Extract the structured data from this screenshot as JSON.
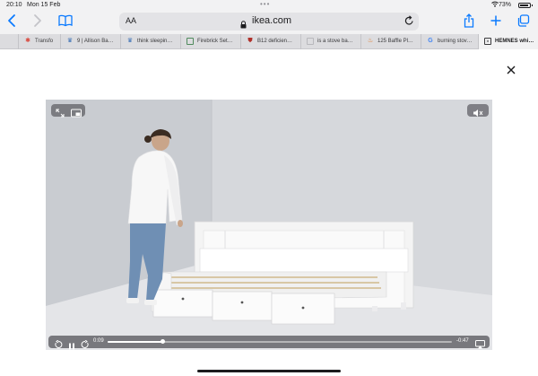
{
  "status": {
    "time": "20:10",
    "date": "Mon 15 Feb",
    "battery": "73%",
    "battery_level": 0.73
  },
  "toolbar": {
    "text_size_label": "AA",
    "url": "ikea.com"
  },
  "tabs": [
    {
      "label": "Transfo",
      "favicon": "star-icon",
      "color": "#d9453a"
    },
    {
      "label": "9 | Allison Ba…",
      "favicon": "crown-icon",
      "color": "#3a6fb5"
    },
    {
      "label": "think sleepin…",
      "favicon": "crown-icon",
      "color": "#3a6fb5"
    },
    {
      "label": "Firebrick Set…",
      "favicon": "grid-icon",
      "color": "#4f8a5c"
    },
    {
      "label": "B12 deficien…",
      "favicon": "shield-icon",
      "color": "#b0302a"
    },
    {
      "label": "is a stove ba…",
      "favicon": "blank-page-icon",
      "color": "#b8b8bc"
    },
    {
      "label": "125 Baffle Pl…",
      "favicon": "flame-icon",
      "color": "#e07a2a"
    },
    {
      "label": "burning stov…",
      "favicon": "google-icon",
      "color": "#4285f4"
    },
    {
      "label": "HEMNES whi…",
      "favicon": "close-tab-icon",
      "color": "#3a3a3c"
    }
  ],
  "video": {
    "elapsed": "0:09",
    "remaining": "-0:47",
    "progress": 0.16
  },
  "colors": {
    "accent": "#0a7aff",
    "video_background": "#d3d5da",
    "daybed": "#f5f5f5"
  }
}
